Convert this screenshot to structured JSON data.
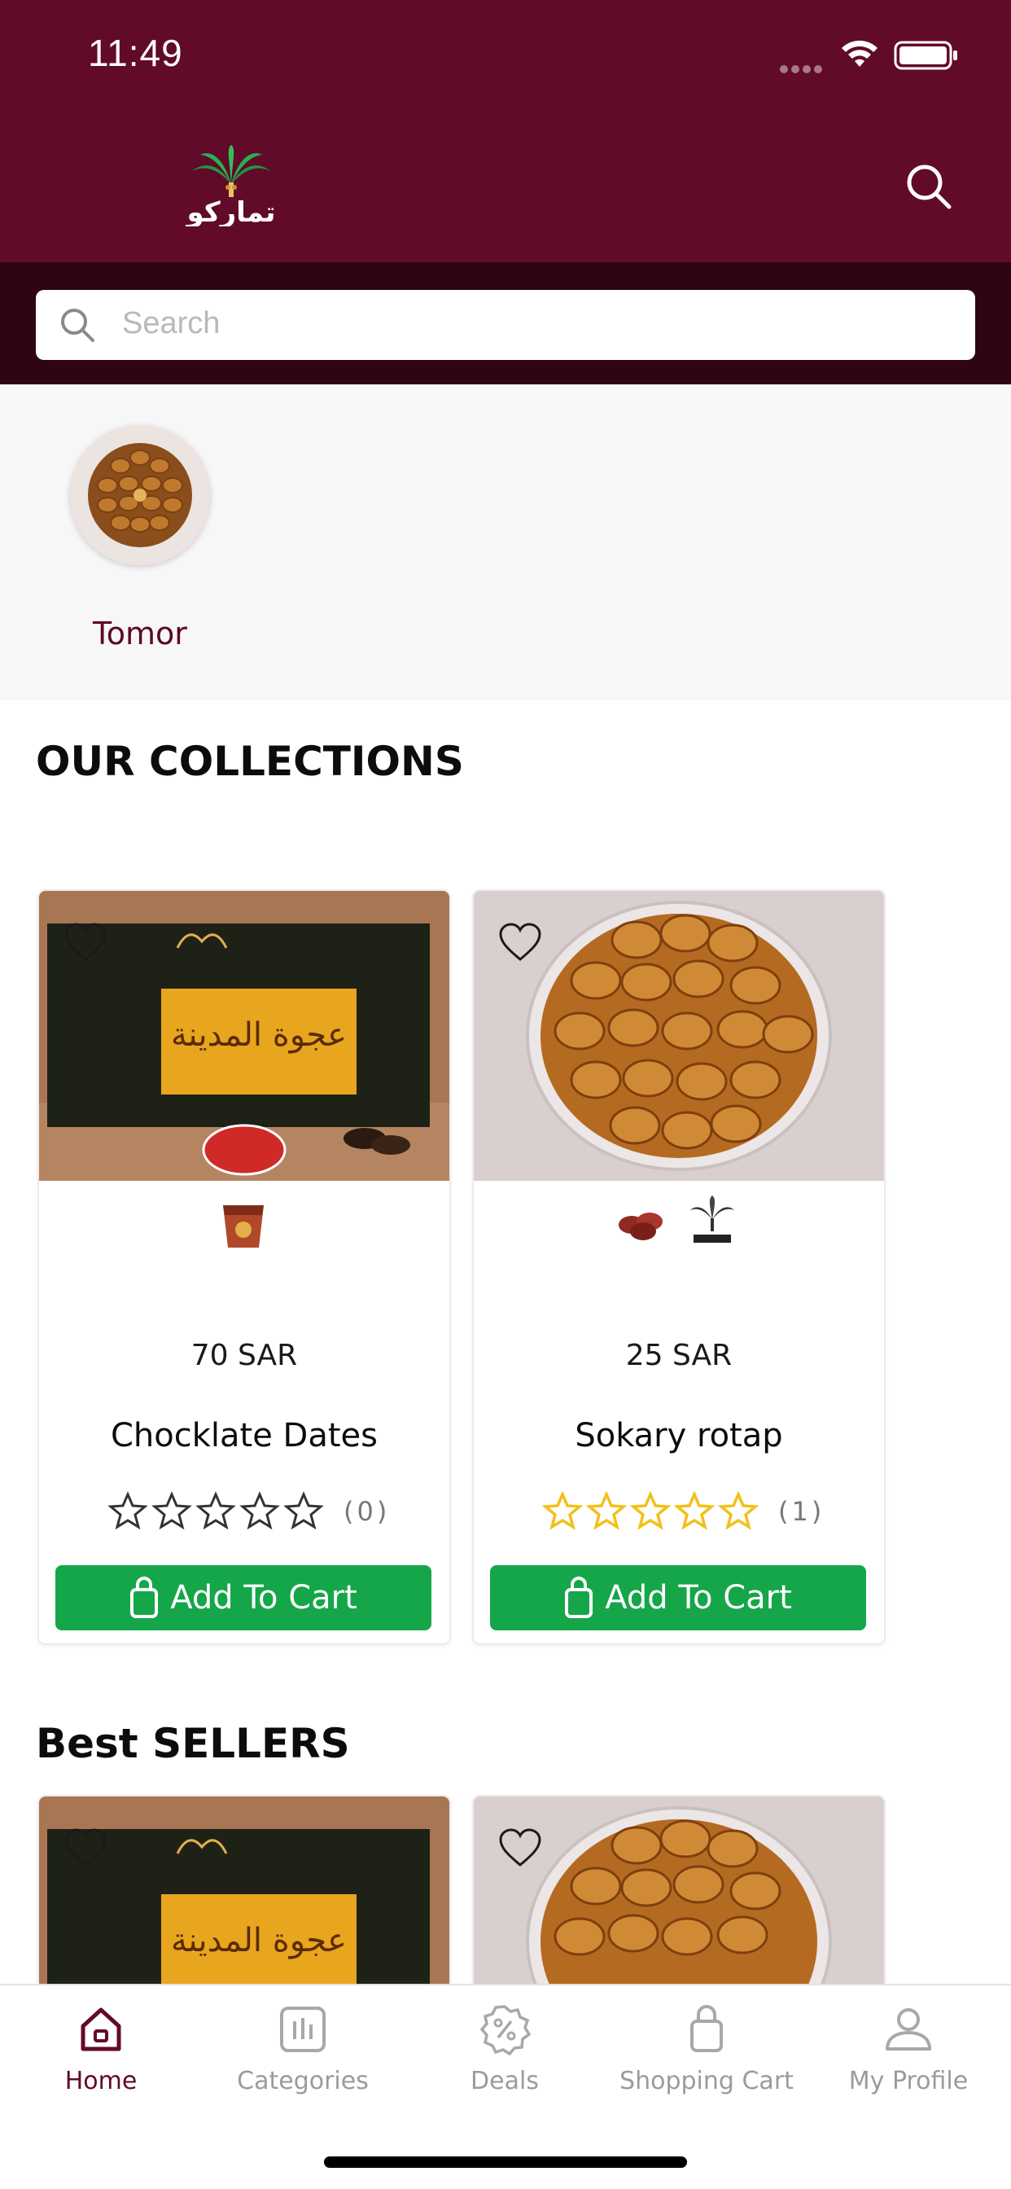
{
  "status_bar": {
    "time": "11:49"
  },
  "header": {
    "logo_text": "تماركو"
  },
  "search": {
    "placeholder": "Search"
  },
  "categories": [
    {
      "label": "Tomor"
    }
  ],
  "collections": {
    "title": "OUR COLLECTIONS",
    "products": [
      {
        "price": "70 SAR",
        "name": "Chocklate Dates",
        "rating_count": "(0)",
        "stars_filled": 0,
        "button": "Add To Cart",
        "box_label": "عجوة المدينة"
      },
      {
        "price": "25 SAR",
        "name": "Sokary rotap",
        "rating_count": "(1)",
        "stars_filled": 0,
        "button": "Add To Cart"
      }
    ]
  },
  "best_sellers": {
    "title": "Best SELLERS"
  },
  "tabs": [
    {
      "label": "Home",
      "icon": "home-icon",
      "active": true
    },
    {
      "label": "Categories",
      "icon": "categories-icon"
    },
    {
      "label": "Deals",
      "icon": "deals-icon"
    },
    {
      "label": "Shopping Cart",
      "icon": "cart-icon"
    },
    {
      "label": "My Profile",
      "icon": "profile-icon"
    }
  ],
  "colors": {
    "brand": "#620a29",
    "search_band": "#2f0514",
    "cart_button": "#15a64a",
    "star_gold": "#f3c018"
  }
}
